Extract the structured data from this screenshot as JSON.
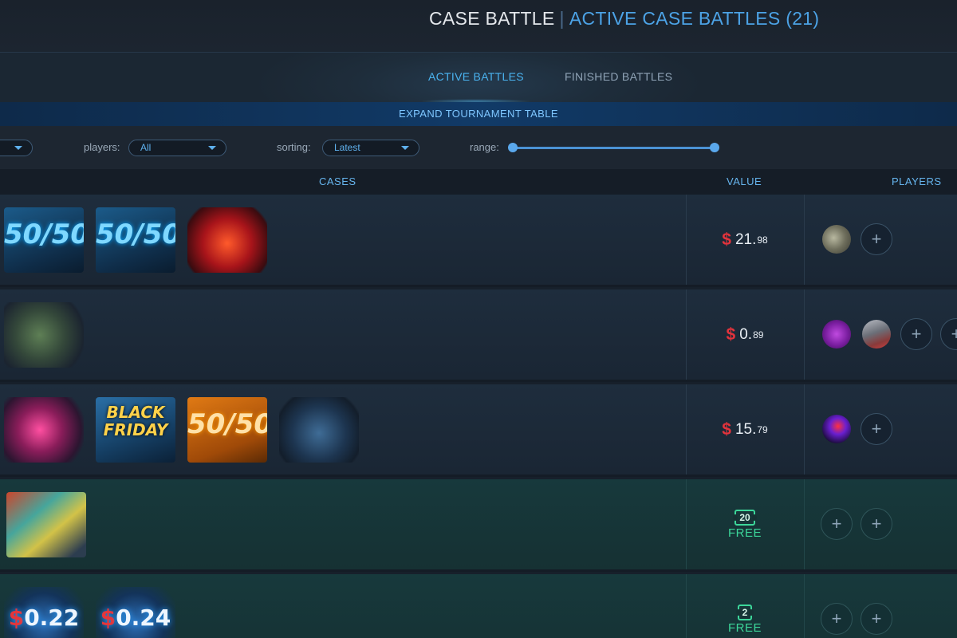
{
  "header": {
    "title": "CASE BATTLE",
    "separator": "|",
    "subtitle": "ACTIVE CASE BATTLES (21)"
  },
  "tabs": [
    {
      "label": "ACTIVE BATTLES",
      "active": true
    },
    {
      "label": "FINISHED BATTLES",
      "active": false
    }
  ],
  "tournament": {
    "expand_label": "EXPAND TOURNAMENT TABLE"
  },
  "filters": {
    "players_label": "players:",
    "players_value": "All",
    "sorting_label": "sorting:",
    "sorting_value": "Latest",
    "range_label": "range:"
  },
  "table": {
    "columns": [
      "CASES",
      "VALUE",
      "PLAYERS"
    ]
  },
  "battles": [
    {
      "cases": [
        {
          "icon": "case-5050-blue",
          "label": "50/50"
        },
        {
          "icon": "case-5050-blue",
          "label": "50/50"
        },
        {
          "icon": "case-red-box",
          "label": ""
        }
      ],
      "value_currency": "$",
      "value_whole": "21.",
      "value_cents": "98",
      "players": [
        "avatar-grey",
        "join"
      ]
    },
    {
      "cases": [
        {
          "icon": "case-green-soldier-box",
          "label": ""
        }
      ],
      "value_currency": "$",
      "value_whole": "0.",
      "value_cents": "89",
      "players": [
        "avatar-purple",
        "avatar-photo",
        "join",
        "join"
      ]
    },
    {
      "cases": [
        {
          "icon": "case-pink-box",
          "label": ""
        },
        {
          "icon": "case-black-friday",
          "label": "BLACK FRIDAY"
        },
        {
          "icon": "case-5050-orange",
          "label": "50/50"
        },
        {
          "icon": "case-dark-box",
          "label": ""
        }
      ],
      "value_currency": "$",
      "value_whole": "15.",
      "value_cents": "79",
      "players": [
        "avatar-red-purple",
        "join"
      ]
    },
    {
      "cases": [
        {
          "icon": "case-graffiti-gun",
          "label": ""
        }
      ],
      "free_ticket": "20",
      "free_label": "FREE",
      "players": [
        "join",
        "join"
      ]
    },
    {
      "cases": [
        {
          "icon": "case-price",
          "currency": "$",
          "label": "0.22"
        },
        {
          "icon": "case-price",
          "currency": "$",
          "label": "0.24"
        }
      ],
      "free_ticket": "2",
      "free_label": "FREE",
      "players": [
        "join",
        "join"
      ]
    }
  ],
  "join_symbol": "+",
  "colors": {
    "accent": "#4ab3f0",
    "price_dollar": "#e3333c",
    "free_green": "#3cd79a",
    "background": "#17202b"
  }
}
